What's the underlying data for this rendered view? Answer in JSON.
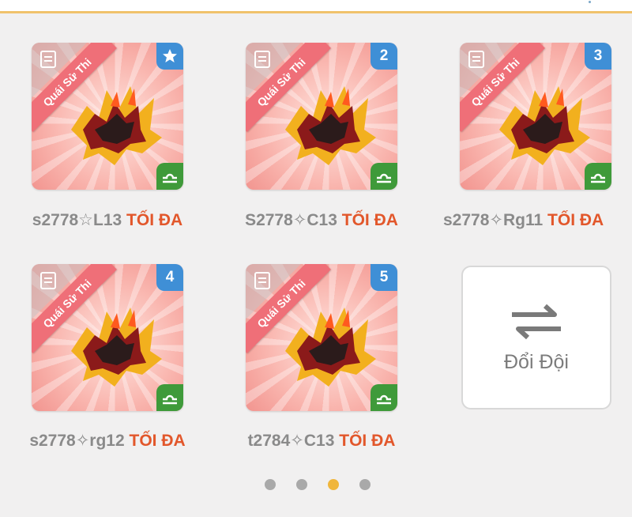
{
  "cards": [
    {
      "badge": "star",
      "name": "s2778☆L13",
      "max": "TỐI ĐA",
      "ribbon": "Quái Sử Thi"
    },
    {
      "badge": "2",
      "name": "S2778✧C13",
      "max": "TỐI ĐA",
      "ribbon": "Quái Sử Thi"
    },
    {
      "badge": "3",
      "name": "s2778✧Rg11",
      "max": "TỐI ĐA",
      "ribbon": "Quái Sử Thi"
    },
    {
      "badge": "4",
      "name": "s2778✧rg12",
      "max": "TỐI ĐA",
      "ribbon": "Quái Sử Thi"
    },
    {
      "badge": "5",
      "name": "t2784✧C13",
      "max": "TỐI ĐA",
      "ribbon": "Quái Sử Thi"
    }
  ],
  "swap": {
    "label": "Đổi Đội",
    "icon": "swap-arrows-icon"
  },
  "pagination": {
    "total": 4,
    "active_index": 3
  },
  "colors": {
    "badge_blue": "#3f8fd6",
    "zodiac_green": "#3f9a3a",
    "max_orange": "#e2572b",
    "active_dot": "#f0b63c"
  }
}
